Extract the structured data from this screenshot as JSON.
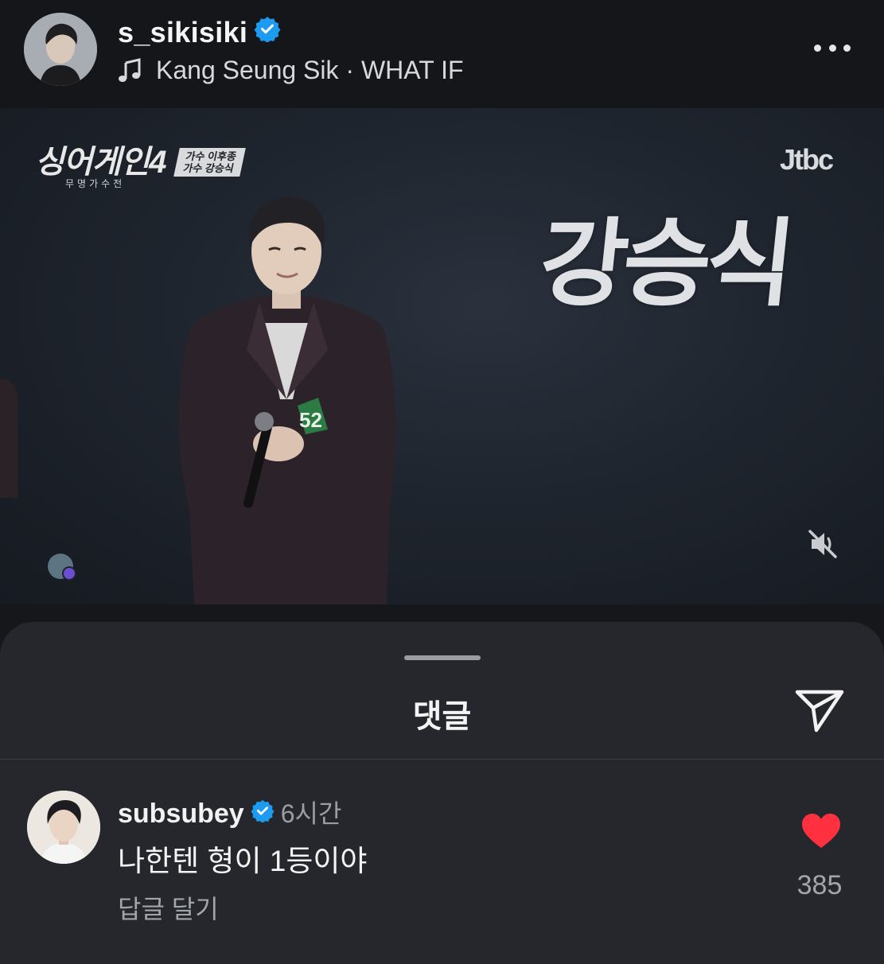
{
  "post": {
    "username": "s_sikisiki",
    "verified": true,
    "music": "Kang Seung Sik · WHAT IF",
    "icons": {
      "music": "music-note-icon",
      "more": "more-horizontal-icon",
      "verified": "verified-badge-icon"
    }
  },
  "video": {
    "show_logo": "싱어게인4",
    "show_subtitle": "무명가수전",
    "show_tag_line1": "가수 이후종",
    "show_tag_line2": "가수 강승식",
    "broadcaster": "Jtbc",
    "name_caption": "강승식",
    "contestant_number": "52",
    "muted": true,
    "icons": {
      "mute": "speaker-muted-icon"
    }
  },
  "comments_sheet": {
    "title": "댓글",
    "icons": {
      "share": "send-paper-plane-icon"
    },
    "comments": [
      {
        "username": "subsubey",
        "verified": true,
        "time": "6시간",
        "text": "나한텐 형이 1등이야",
        "reply_label": "답글 달기",
        "liked": true,
        "like_count": "385"
      }
    ]
  },
  "colors": {
    "verified_blue": "#1d9bf0",
    "like_red": "#ff3040",
    "background": "#15171b",
    "sheet": "#25272c"
  }
}
